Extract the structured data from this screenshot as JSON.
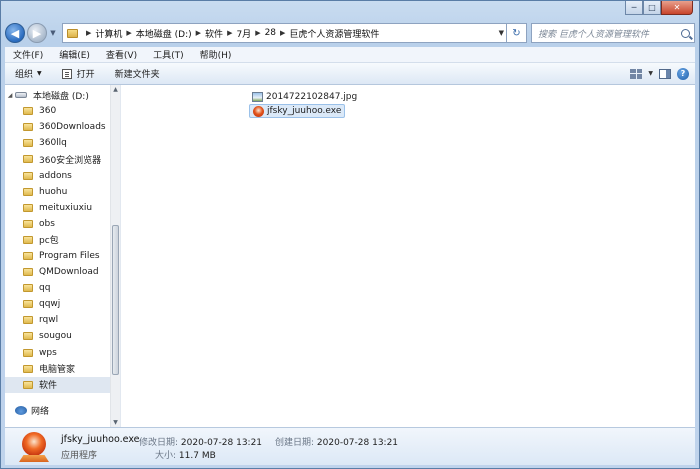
{
  "window": {
    "caption": {
      "minimize": "─",
      "maximize": "□",
      "close": "✕"
    }
  },
  "nav": {
    "back_icon": "arrow-left-icon",
    "forward_icon": "arrow-right-icon",
    "breadcrumbs": [
      "计算机",
      "本地磁盘 (D:)",
      "软件",
      "7月",
      "28",
      "巨虎个人资源管理软件"
    ],
    "search_placeholder": "搜索 巨虎个人资源管理软件"
  },
  "menubar": {
    "items": [
      "文件(F)",
      "编辑(E)",
      "查看(V)",
      "工具(T)",
      "帮助(H)"
    ]
  },
  "toolbar": {
    "organize_label": "组织",
    "open_label": "打开",
    "new_folder_label": "新建文件夹"
  },
  "tree": {
    "drive_label": "本地磁盘 (D:)",
    "folders": [
      "360",
      "360Downloads",
      "360llq",
      "360安全浏览器",
      "addons",
      "huohu",
      "meituxiuxiu",
      "obs",
      "pc包",
      "Program Files",
      "QMDownload",
      "qq",
      "qqwj",
      "rqwl",
      "sougou",
      "wps",
      "电脑管家",
      "软件"
    ],
    "selected_folder": "软件",
    "network_label": "网络"
  },
  "files": [
    {
      "name": "2014722102847.jpg",
      "icon": "image-file-icon",
      "selected": false
    },
    {
      "name": "jfsky_juuhoo.exe",
      "icon": "exe-app-icon",
      "selected": true
    }
  ],
  "details": {
    "file_name": "jfsky_juuhoo.exe",
    "file_type": "应用程序",
    "modified_label": "修改日期:",
    "modified_value": "2020-07-28 13:21",
    "created_label": "创建日期:",
    "created_value": "2020-07-28 13:21",
    "size_label": "大小:",
    "size_value": "11.7 MB"
  }
}
